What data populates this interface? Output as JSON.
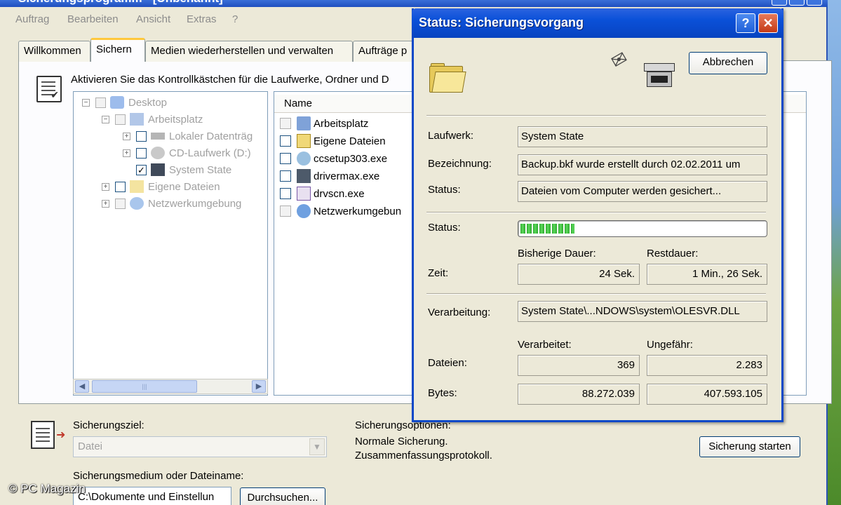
{
  "main_window": {
    "title": "Sicherungsprogramm - [Unbenannt]",
    "menu": [
      "Auftrag",
      "Bearbeiten",
      "Ansicht",
      "Extras",
      "?"
    ],
    "tabs": [
      "Willkommen",
      "Sichern",
      "Medien wiederherstellen und verwalten",
      "Aufträge p"
    ],
    "active_tab": "Sichern",
    "hint_text": "Aktivieren Sie das Kontrollkästchen für die Laufwerke, Ordner und D",
    "tree": [
      {
        "label": "Desktop",
        "state": "grey"
      },
      {
        "label": "Arbeitsplatz",
        "state": "grey"
      },
      {
        "label": "Lokaler Datenträg",
        "state": "unchecked"
      },
      {
        "label": "CD-Laufwerk (D:)",
        "state": "unchecked"
      },
      {
        "label": "System State",
        "state": "checked"
      },
      {
        "label": "Eigene Dateien",
        "state": "unchecked"
      },
      {
        "label": "Netzwerkumgebung",
        "state": "grey"
      }
    ],
    "list_header": "Name",
    "list_items": [
      {
        "label": "Arbeitsplatz",
        "state": "grey"
      },
      {
        "label": "Eigene Dateien",
        "state": "unchecked"
      },
      {
        "label": "ccsetup303.exe",
        "state": "unchecked"
      },
      {
        "label": "drivermax.exe",
        "state": "unchecked"
      },
      {
        "label": "drvscn.exe",
        "state": "unchecked"
      },
      {
        "label": "Netzwerkumgebun",
        "state": "grey"
      }
    ],
    "backup_target_label": "Sicherungsziel:",
    "backup_target_value": "Datei",
    "backup_options_label": "Sicherungsoptionen:",
    "backup_options_line1": "Normale Sicherung.",
    "backup_options_line2": "Zusammenfassungsprotokoll.",
    "start_button": "Sicherung starten",
    "media_label": "Sicherungsmedium oder Dateiname:",
    "media_value": "C:\\Dokumente und Einstellun",
    "browse_button": "Durchsuchen..."
  },
  "dialog": {
    "title": "Status: Sicherungsvorgang",
    "help_button": "?",
    "close_button": "✕",
    "cancel_button": "Abbrechen",
    "drive_label": "Laufwerk:",
    "drive_value": "System State",
    "label_label": "Bezeichnung:",
    "label_value": "Backup.bkf wurde erstellt durch 02.02.2011 um",
    "status_label": "Status:",
    "status_value": "Dateien vom Computer werden gesichert...",
    "progress_label": "Status:",
    "progress_fraction": 0.22,
    "elapsed_header": "Bisherige Dauer:",
    "remaining_header": "Restdauer:",
    "time_label": "Zeit:",
    "elapsed_value": "24 Sek.",
    "remaining_value": "1 Min., 26 Sek.",
    "processing_label": "Verarbeitung:",
    "processing_value": "System State\\...NDOWS\\system\\OLESVR.DLL",
    "processed_header": "Verarbeitet:",
    "approx_header": "Ungefähr:",
    "files_label": "Dateien:",
    "files_processed": "369",
    "files_approx": "2.283",
    "bytes_label": "Bytes:",
    "bytes_processed": "88.272.039",
    "bytes_approx": "407.593.105"
  },
  "watermark": "© PC Magazin",
  "colors": {
    "xp_blue": "#0a50d8",
    "window_bg": "#ece9d8",
    "progress_green": "#2fa82f",
    "close_red": "#c43a16"
  }
}
